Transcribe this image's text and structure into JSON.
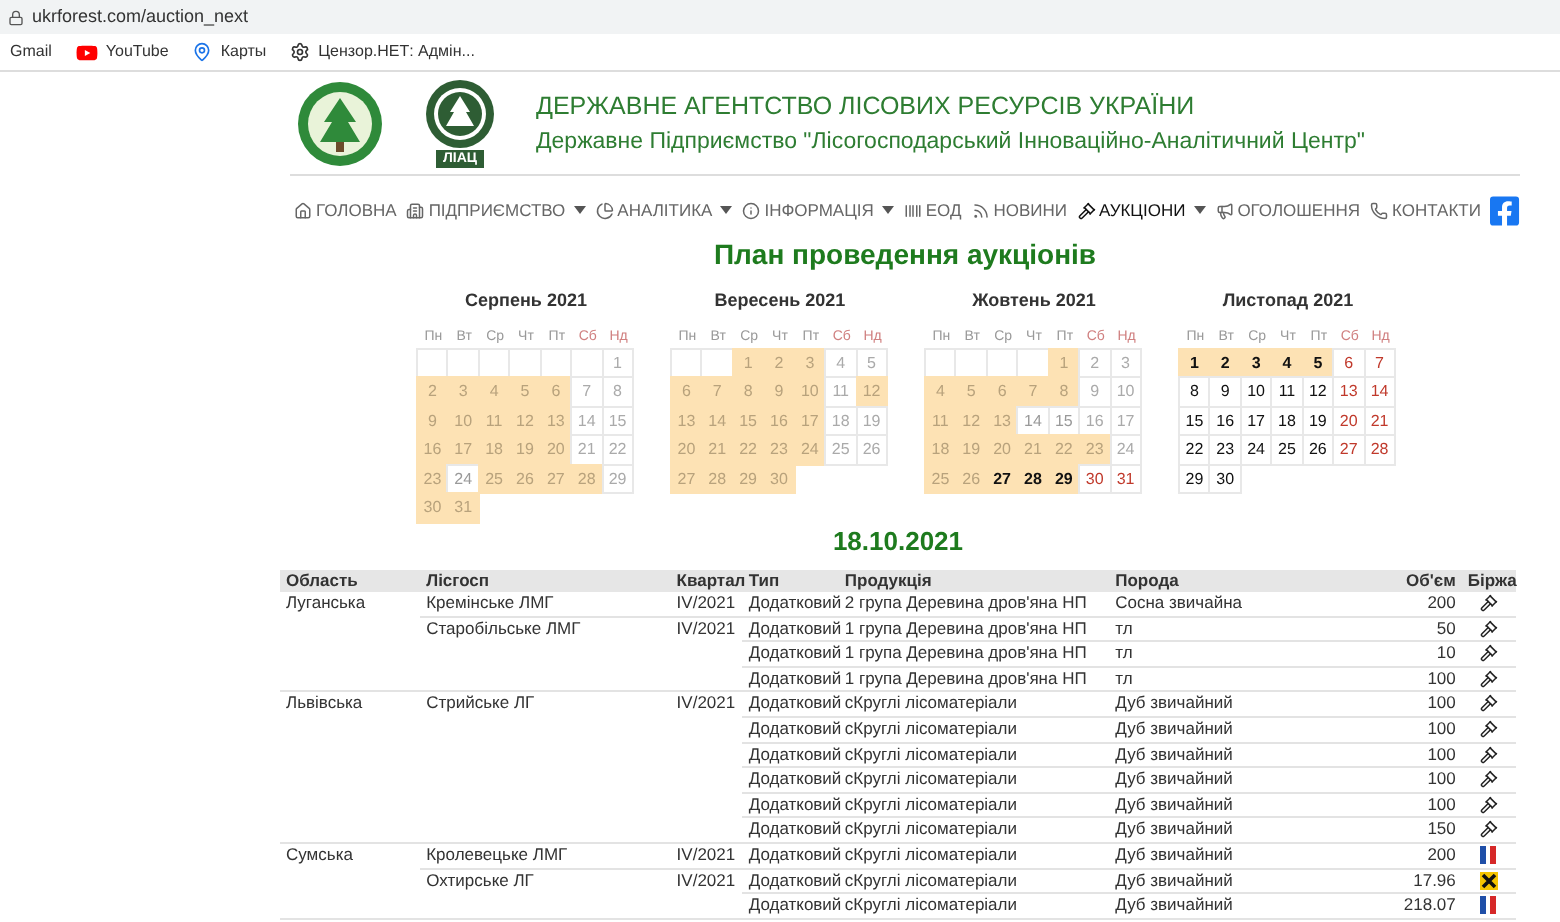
{
  "browser": {
    "url": "ukrforest.com/auction_next",
    "bookmarks": [
      {
        "label": "Gmail",
        "kind": "plain"
      },
      {
        "label": "YouTube",
        "kind": "youtube"
      },
      {
        "label": "Карты",
        "kind": "maps"
      },
      {
        "label": "Цензор.НЕТ: Адмін...",
        "kind": "gear"
      }
    ]
  },
  "header": {
    "title": "ДЕРЖАВНЕ АГЕНТСТВО ЛІСОВИХ РЕСУРСІВ УКРАЇНИ",
    "subtitle": "Державне Підприємство \"Лісогосподарський Інноваційно-Аналітичний Центр\"",
    "logo_text": "ЛІАЦ"
  },
  "nav": [
    {
      "label": "ГОЛОВНА",
      "kind": "home",
      "dropdown": false,
      "selected": false
    },
    {
      "label": "ПІДПРИЄМСТВО",
      "kind": "building",
      "dropdown": true,
      "selected": false
    },
    {
      "label": "АНАЛІТИКА",
      "kind": "chart",
      "dropdown": true,
      "selected": false
    },
    {
      "label": "ІНФОРМАЦІЯ",
      "kind": "info",
      "dropdown": true,
      "selected": false
    },
    {
      "label": "ЕОД",
      "kind": "barcode",
      "dropdown": false,
      "selected": false
    },
    {
      "label": "НОВИНИ",
      "kind": "rss",
      "dropdown": false,
      "selected": false
    },
    {
      "label": "АУКЦІОНИ",
      "kind": "gavel",
      "dropdown": true,
      "selected": true
    },
    {
      "label": "ОГОЛОШЕННЯ",
      "kind": "megaphone",
      "dropdown": false,
      "selected": false
    },
    {
      "label": "КОНТАКТИ",
      "kind": "phone",
      "dropdown": false,
      "selected": false
    }
  ],
  "page_title": "План проведення аукціонів",
  "calendars": [
    {
      "title": "Серпень 2021",
      "weekdays": [
        "Пн",
        "Вт",
        "Ср",
        "Чт",
        "Пт",
        "Сб",
        "Нд"
      ],
      "weeks": [
        {
          "days": [
            {
              "day": "1",
              "marked": false,
              "past": true
            }
          ]
        },
        {
          "days": [
            {
              "day": "2",
              "marked": true,
              "past": true
            },
            {
              "day": "3",
              "marked": true,
              "past": true
            },
            {
              "day": "4",
              "marked": true,
              "past": true
            },
            {
              "day": "5",
              "marked": true,
              "past": true
            },
            {
              "day": "6",
              "marked": true,
              "past": true
            },
            {
              "day": "7",
              "marked": false,
              "past": true
            },
            {
              "day": "8",
              "marked": false,
              "past": true
            }
          ]
        },
        {
          "days": [
            {
              "day": "9",
              "marked": true,
              "past": true
            },
            {
              "day": "10",
              "marked": true,
              "past": true
            },
            {
              "day": "11",
              "marked": true,
              "past": true
            },
            {
              "day": "12",
              "marked": true,
              "past": true
            },
            {
              "day": "13",
              "marked": true,
              "past": true
            },
            {
              "day": "14",
              "marked": false,
              "past": true
            },
            {
              "day": "15",
              "marked": false,
              "past": true
            }
          ]
        },
        {
          "days": [
            {
              "day": "16",
              "marked": true,
              "past": true
            },
            {
              "day": "17",
              "marked": true,
              "past": true
            },
            {
              "day": "18",
              "marked": true,
              "past": true
            },
            {
              "day": "19",
              "marked": true,
              "past": true
            },
            {
              "day": "20",
              "marked": true,
              "past": true
            },
            {
              "day": "21",
              "marked": false,
              "past": true
            },
            {
              "day": "22",
              "marked": false,
              "past": true
            }
          ]
        },
        {
          "days": [
            {
              "day": "23",
              "marked": true,
              "past": true
            },
            {
              "day": "24",
              "marked": false,
              "past": true
            },
            {
              "day": "25",
              "marked": true,
              "past": true
            },
            {
              "day": "26",
              "marked": true,
              "past": true
            },
            {
              "day": "27",
              "marked": true,
              "past": true
            },
            {
              "day": "28",
              "marked": true,
              "past": true
            },
            {
              "day": "29",
              "marked": false,
              "past": true
            }
          ]
        },
        {
          "days": [
            {
              "day": "30",
              "marked": true,
              "past": true
            },
            {
              "day": "31",
              "marked": true,
              "past": true
            }
          ]
        }
      ]
    },
    {
      "title": "Вересень 2021",
      "weekdays": [
        "Пн",
        "Вт",
        "Ср",
        "Чт",
        "Пт",
        "Сб",
        "Нд"
      ],
      "weeks": [
        {
          "days": [
            {
              "day": "1",
              "marked": true,
              "past": true
            },
            {
              "day": "2",
              "marked": true,
              "past": true
            },
            {
              "day": "3",
              "marked": true,
              "past": true
            },
            {
              "day": "4",
              "marked": false,
              "past": true
            },
            {
              "day": "5",
              "marked": false,
              "past": true
            }
          ]
        },
        {
          "days": [
            {
              "day": "6",
              "marked": true,
              "past": true
            },
            {
              "day": "7",
              "marked": true,
              "past": true
            },
            {
              "day": "8",
              "marked": true,
              "past": true
            },
            {
              "day": "9",
              "marked": true,
              "past": true
            },
            {
              "day": "10",
              "marked": true,
              "past": true
            },
            {
              "day": "11",
              "marked": false,
              "past": true
            },
            {
              "day": "12",
              "marked": true,
              "past": true
            }
          ]
        },
        {
          "days": [
            {
              "day": "13",
              "marked": true,
              "past": true
            },
            {
              "day": "14",
              "marked": true,
              "past": true
            },
            {
              "day": "15",
              "marked": true,
              "past": true
            },
            {
              "day": "16",
              "marked": true,
              "past": true
            },
            {
              "day": "17",
              "marked": true,
              "past": true
            },
            {
              "day": "18",
              "marked": false,
              "past": true
            },
            {
              "day": "19",
              "marked": false,
              "past": true
            }
          ]
        },
        {
          "days": [
            {
              "day": "20",
              "marked": true,
              "past": true
            },
            {
              "day": "21",
              "marked": true,
              "past": true
            },
            {
              "day": "22",
              "marked": true,
              "past": true
            },
            {
              "day": "23",
              "marked": true,
              "past": true
            },
            {
              "day": "24",
              "marked": true,
              "past": true
            },
            {
              "day": "25",
              "marked": false,
              "past": true
            },
            {
              "day": "26",
              "marked": false,
              "past": true
            }
          ]
        },
        {
          "days": [
            {
              "day": "27",
              "marked": true,
              "past": true
            },
            {
              "day": "28",
              "marked": true,
              "past": true
            },
            {
              "day": "29",
              "marked": true,
              "past": true
            },
            {
              "day": "30",
              "marked": true,
              "past": true
            }
          ]
        }
      ]
    },
    {
      "title": "Жовтень 2021",
      "weekdays": [
        "Пн",
        "Вт",
        "Ср",
        "Чт",
        "Пт",
        "Сб",
        "Нд"
      ],
      "weeks": [
        {
          "days": [
            {
              "day": "1",
              "marked": true,
              "past": true
            },
            {
              "day": "2",
              "marked": false,
              "past": true
            },
            {
              "day": "3",
              "marked": false,
              "past": true
            }
          ]
        },
        {
          "days": [
            {
              "day": "4",
              "marked": true,
              "past": true
            },
            {
              "day": "5",
              "marked": true,
              "past": true
            },
            {
              "day": "6",
              "marked": true,
              "past": true
            },
            {
              "day": "7",
              "marked": true,
              "past": true
            },
            {
              "day": "8",
              "marked": true,
              "past": true
            },
            {
              "day": "9",
              "marked": false,
              "past": true
            },
            {
              "day": "10",
              "marked": false,
              "past": true
            }
          ]
        },
        {
          "days": [
            {
              "day": "11",
              "marked": true,
              "past": true
            },
            {
              "day": "12",
              "marked": true,
              "past": true
            },
            {
              "day": "13",
              "marked": true,
              "past": true
            },
            {
              "day": "14",
              "marked": false,
              "past": true
            },
            {
              "day": "15",
              "marked": false,
              "past": true
            },
            {
              "day": "16",
              "marked": false,
              "past": true
            },
            {
              "day": "17",
              "marked": false,
              "past": true
            }
          ]
        },
        {
          "days": [
            {
              "day": "18",
              "marked": true,
              "past": true
            },
            {
              "day": "19",
              "marked": true,
              "past": true
            },
            {
              "day": "20",
              "marked": true,
              "past": true
            },
            {
              "day": "21",
              "marked": true,
              "past": true
            },
            {
              "day": "22",
              "marked": true,
              "past": true
            },
            {
              "day": "23",
              "marked": true,
              "past": true
            },
            {
              "day": "24",
              "marked": false,
              "past": true
            }
          ]
        },
        {
          "days": [
            {
              "day": "25",
              "marked": true,
              "past": true
            },
            {
              "day": "26",
              "marked": true,
              "past": true
            },
            {
              "day": "27",
              "marked": true,
              "past": false
            },
            {
              "day": "28",
              "marked": true,
              "past": false
            },
            {
              "day": "29",
              "marked": true,
              "past": false
            },
            {
              "day": "30",
              "marked": false,
              "past": false
            },
            {
              "day": "31",
              "marked": false,
              "past": false
            }
          ]
        }
      ]
    },
    {
      "title": "Листопад 2021",
      "weekdays": [
        "Пн",
        "Вт",
        "Ср",
        "Чт",
        "Пт",
        "Сб",
        "Нд"
      ],
      "weeks": [
        {
          "days": [
            {
              "day": "1",
              "marked": true,
              "past": false
            },
            {
              "day": "2",
              "marked": true,
              "past": false
            },
            {
              "day": "3",
              "marked": true,
              "past": false
            },
            {
              "day": "4",
              "marked": true,
              "past": false
            },
            {
              "day": "5",
              "marked": true,
              "past": false
            },
            {
              "day": "6",
              "marked": false,
              "past": false
            },
            {
              "day": "7",
              "marked": false,
              "past": false
            }
          ]
        },
        {
          "days": [
            {
              "day": "8",
              "marked": false,
              "past": false
            },
            {
              "day": "9",
              "marked": false,
              "past": false
            },
            {
              "day": "10",
              "marked": false,
              "past": false
            },
            {
              "day": "11",
              "marked": false,
              "past": false
            },
            {
              "day": "12",
              "marked": false,
              "past": false
            },
            {
              "day": "13",
              "marked": false,
              "past": false
            },
            {
              "day": "14",
              "marked": false,
              "past": false
            }
          ]
        },
        {
          "days": [
            {
              "day": "15",
              "marked": false,
              "past": false
            },
            {
              "day": "16",
              "marked": false,
              "past": false
            },
            {
              "day": "17",
              "marked": false,
              "past": false
            },
            {
              "day": "18",
              "marked": false,
              "past": false
            },
            {
              "day": "19",
              "marked": false,
              "past": false
            },
            {
              "day": "20",
              "marked": false,
              "past": false
            },
            {
              "day": "21",
              "marked": false,
              "past": false
            }
          ]
        },
        {
          "days": [
            {
              "day": "22",
              "marked": false,
              "past": false
            },
            {
              "day": "23",
              "marked": false,
              "past": false
            },
            {
              "day": "24",
              "marked": false,
              "past": false
            },
            {
              "day": "25",
              "marked": false,
              "past": false
            },
            {
              "day": "26",
              "marked": false,
              "past": false
            },
            {
              "day": "27",
              "marked": false,
              "past": false
            },
            {
              "day": "28",
              "marked": false,
              "past": false
            }
          ]
        },
        {
          "days": [
            {
              "day": "29",
              "marked": false,
              "past": false
            },
            {
              "day": "30",
              "marked": false,
              "past": false
            }
          ]
        }
      ]
    }
  ],
  "auction_date": "18.10.2021",
  "table": {
    "columns": [
      "Область",
      "Лісгосп",
      "Квартал",
      "Тип",
      "Продукція",
      "Порода",
      "Об'єм",
      "Біржа"
    ],
    "regions": [
      {
        "name": "Луганська",
        "forestries": [
          {
            "name": "Кремінське ЛМГ",
            "quarter": "IV/2021",
            "lots": [
              {
                "type": "Додатковий",
                "product": "2 група Деревина дров'яна НП",
                "species": "Сосна звичайна",
                "volume": "200",
                "kind": "gavel"
              }
            ]
          },
          {
            "name": "Старобільське ЛМГ",
            "quarter": "IV/2021",
            "lots": [
              {
                "type": "Додатковий",
                "product": "1 група Деревина дров'яна НП",
                "species": "тл",
                "volume": "50",
                "kind": "gavel"
              },
              {
                "type": "Додатковий",
                "product": "1 група Деревина дров'яна НП",
                "species": "тл",
                "volume": "10",
                "kind": "gavel"
              },
              {
                "type": "Додатковий",
                "product": "1 група Деревина дров'яна НП",
                "species": "тл",
                "volume": "100",
                "kind": "gavel"
              }
            ]
          }
        ]
      },
      {
        "name": "Львівська",
        "forestries": [
          {
            "name": "Стрийське ЛГ",
            "quarter": "IV/2021",
            "lots": [
              {
                "type": "Додатковий",
                "product": "сКруглі лісоматеріали",
                "species": "Дуб звичайний",
                "volume": "100",
                "kind": "gavel"
              },
              {
                "type": "Додатковий",
                "product": "сКруглі лісоматеріали",
                "species": "Дуб звичайний",
                "volume": "100",
                "kind": "gavel"
              },
              {
                "type": "Додатковий",
                "product": "сКруглі лісоматеріали",
                "species": "Дуб звичайний",
                "volume": "100",
                "kind": "gavel"
              },
              {
                "type": "Додатковий",
                "product": "сКруглі лісоматеріали",
                "species": "Дуб звичайний",
                "volume": "100",
                "kind": "gavel"
              },
              {
                "type": "Додатковий",
                "product": "сКруглі лісоматеріали",
                "species": "Дуб звичайний",
                "volume": "100",
                "kind": "gavel"
              },
              {
                "type": "Додатковий",
                "product": "сКруглі лісоматеріали",
                "species": "Дуб звичайний",
                "volume": "150",
                "kind": "gavel"
              }
            ]
          }
        ]
      },
      {
        "name": "Сумська",
        "forestries": [
          {
            "name": "Кролевецьке ЛМГ",
            "quarter": "IV/2021",
            "lots": [
              {
                "type": "Додатковий",
                "product": "сКруглі лісоматеріали",
                "species": "Дуб звичайний",
                "volume": "200",
                "kind": "flag"
              }
            ]
          },
          {
            "name": "Охтирське ЛГ",
            "quarter": "IV/2021",
            "lots": [
              {
                "type": "Додатковий",
                "product": "сКруглі лісоматеріали",
                "species": "Дуб звичайний",
                "volume": "17.96",
                "kind": "cross"
              },
              {
                "type": "Додатковий",
                "product": "сКруглі лісоматеріали",
                "species": "Дуб звичайний",
                "volume": "218.07",
                "kind": "flag"
              }
            ]
          }
        ]
      }
    ]
  }
}
